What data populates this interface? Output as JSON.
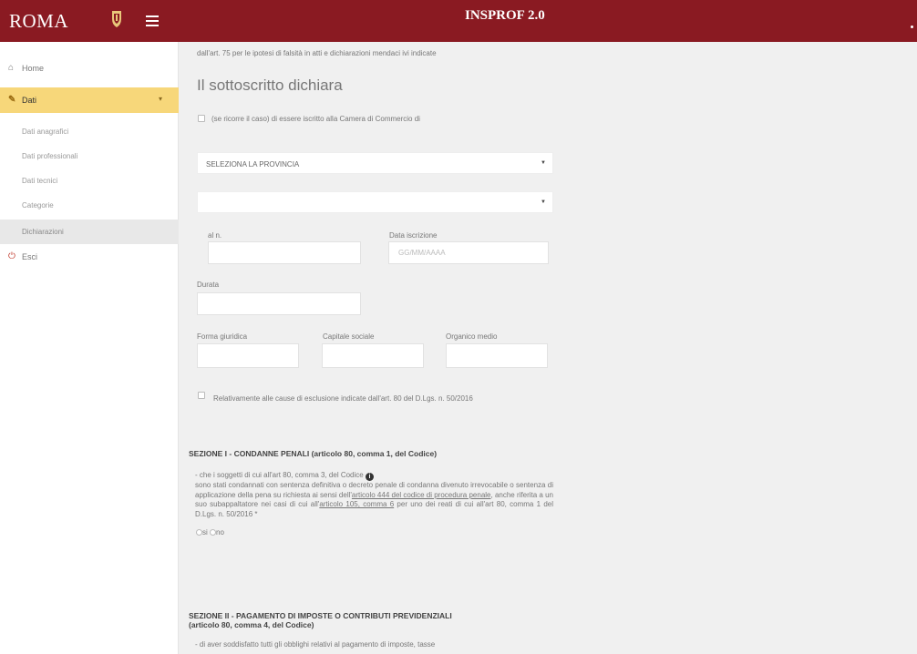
{
  "header": {
    "brand": "ROMA",
    "app_title": "INSPROF 2.0"
  },
  "sidebar": {
    "items": [
      {
        "label": "Home",
        "icon": "home-icon"
      },
      {
        "label": "Dati",
        "icon": "edit-icon",
        "expanded": true
      },
      {
        "label": "Esci",
        "icon": "power-icon"
      }
    ],
    "subitems": [
      {
        "label": "Dati anagrafici"
      },
      {
        "label": "Dati professionali"
      },
      {
        "label": "Dati tecnici"
      },
      {
        "label": "Categorie"
      },
      {
        "label": "Dichiarazioni",
        "selected": true
      }
    ]
  },
  "content": {
    "top_note": "dall'art. 75 per le ipotesi di falsità in atti e dichiarazioni mendaci ivi indicate",
    "heading": "Il sottoscritto dichiara",
    "checkbox1_label": "(se ricorre il caso) di essere iscritto alla Camera di Commercio di",
    "select_provincia": "SELEZIONA LA PROVINCIA",
    "select_2": "",
    "al_n_label": "al n.",
    "data_iscrizione_label": "Data iscrizione",
    "data_iscrizione_placeholder": "GG/MM/AAAA",
    "durata_label": "Durata",
    "forma_giuridica_label": "Forma giuridica",
    "capitale_sociale_label": "Capitale sociale",
    "organico_medio_label": "Organico medio",
    "checkbox2_label": "Relativamente alle cause di esclusione indicate dall'art. 80 del D.Lgs. n. 50/2016",
    "sezione1_title": "SEZIONE I - CONDANNE PENALI (articolo 80, comma 1, del Codice)",
    "sezione1_intro": "- che i soggetti di cui all'art 80, comma 3, del Codice",
    "sezione1_body_1": "sono stati condannati con sentenza definitiva o decreto penale di condanna divenuto irrevocabile o sentenza di applicazione della pena su richiesta ai sensi dell'",
    "sezione1_link1": "articolo 444 del codice di procedura penale",
    "sezione1_body_2": ", anche riferita a un suo subappaltatore nei casi di cui all'",
    "sezione1_link2": "articolo 105, comma 6",
    "sezione1_body_3": " per uno dei reati di cui all'art 80, comma 1 del D.Lgs. n. 50/2016 *",
    "radio_si": "si",
    "radio_no": "no",
    "sezione2_title_1": "SEZIONE II - PAGAMENTO DI IMPOSTE O CONTRIBUTI PREVIDENZIALI",
    "sezione2_title_2": "(articolo 80, comma 4, del Codice)",
    "sezione2_body": "- di aver soddisfatto tutti gli obblighi relativi al pagamento di imposte, tasse"
  }
}
